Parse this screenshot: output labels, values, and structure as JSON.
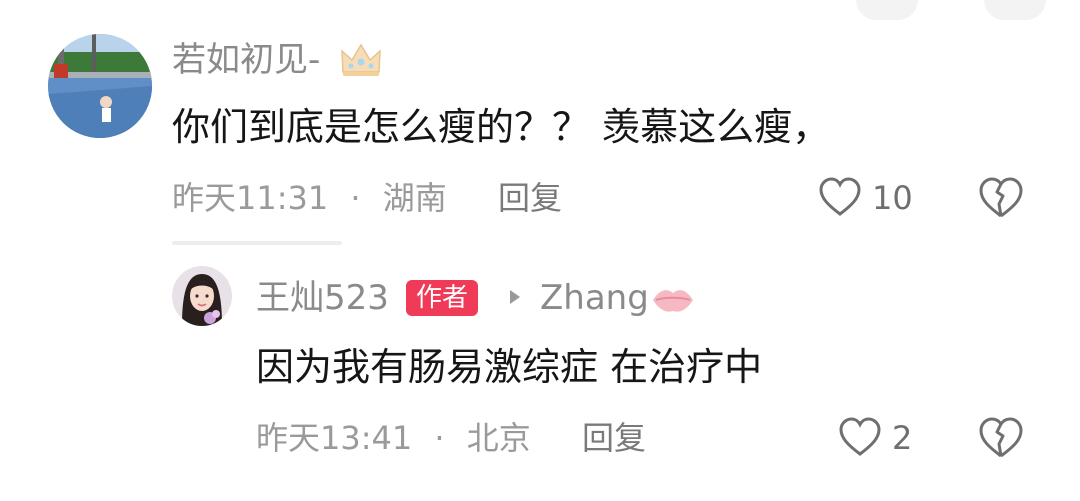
{
  "comment": {
    "username": "若如初见-",
    "badge_icon": "crown-icon",
    "text": "你们到底是怎么瘦的？？ 羡慕这么瘦，",
    "time": "昨天11:31",
    "separator": "·",
    "location": "湖南",
    "reply_label": "回复",
    "like_count": "10"
  },
  "reply": {
    "username": "王灿523",
    "author_badge": "作者",
    "reply_to": "Zhang",
    "reply_to_decoration_icon": "lips-icon",
    "text": "因为我有肠易激综症 在治疗中",
    "time": "昨天13:41",
    "separator": "·",
    "location": "北京",
    "reply_label": "回复",
    "like_count": "2"
  },
  "colors": {
    "author_badge_bg": "#ef3b57",
    "username": "#8a8a8a",
    "text": "#161616"
  }
}
